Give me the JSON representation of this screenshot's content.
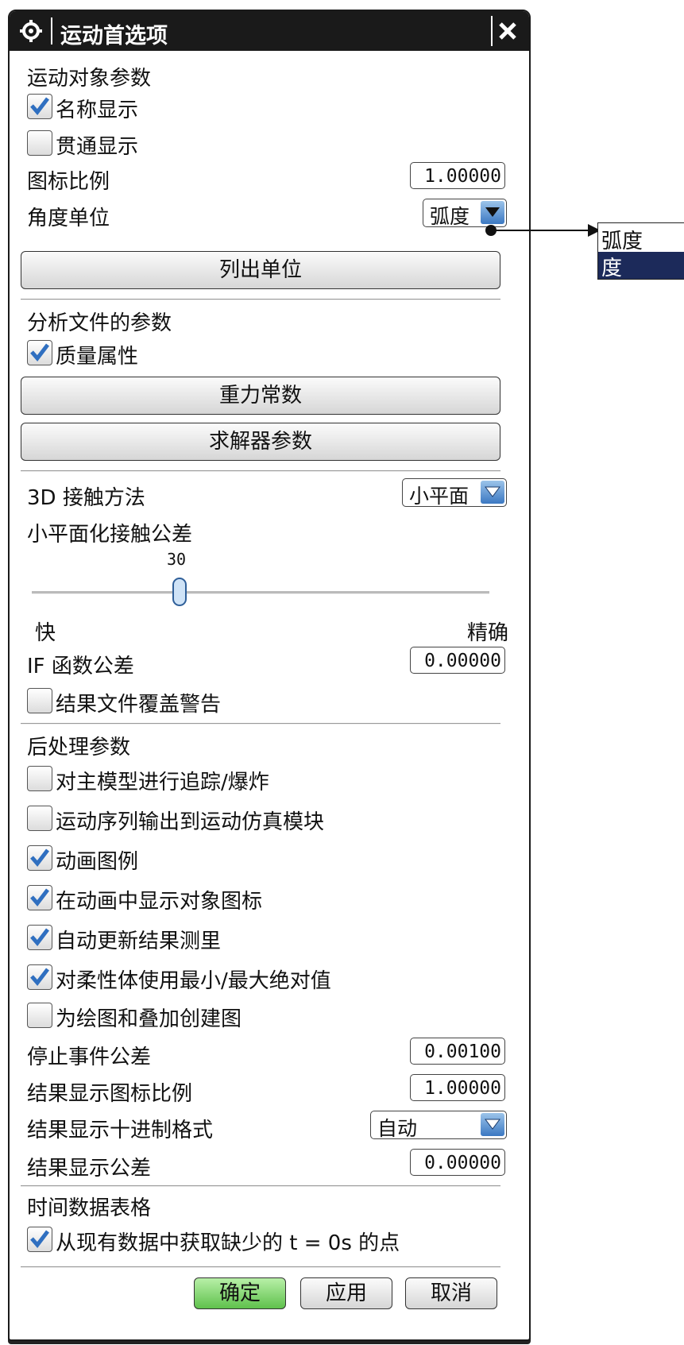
{
  "title": "运动首选项",
  "sections": {
    "motion_obj": "运动对象参数",
    "analysis": "分析文件的参数",
    "post": "后处理参数",
    "time": "时间数据表格"
  },
  "checkboxes": {
    "name_display": {
      "label": "名称显示",
      "checked": true
    },
    "through_display": {
      "label": "贯通显示",
      "checked": false
    },
    "mass_props": {
      "label": "质量属性",
      "checked": true
    },
    "result_overwrite": {
      "label": "结果文件覆盖警告",
      "checked": false
    },
    "trace_explode": {
      "label": "对主模型进行追踪/爆炸",
      "checked": false
    },
    "seq_output": {
      "label": "运动序列输出到运动仿真模块",
      "checked": false
    },
    "anim_legend": {
      "label": "动画图例",
      "checked": true
    },
    "show_icons": {
      "label": "在动画中显示对象图标",
      "checked": true
    },
    "auto_update": {
      "label": "自动更新结果测里",
      "checked": true
    },
    "flex_minmax": {
      "label": "对柔性体使用最小/最大绝对值",
      "checked": true
    },
    "plot_overlay": {
      "label": "为绘图和叠加创建图",
      "checked": false
    },
    "missing_pts": {
      "label": "从现有数据中获取缺少的 t = 0s 的点",
      "checked": true
    }
  },
  "fields": {
    "icon_scale": {
      "label": "图标比例",
      "value": "1.00000"
    },
    "if_tol": {
      "label": "IF 函数公差",
      "value": "0.00000"
    },
    "stop_tol": {
      "label": "停止事件公差",
      "value": "0.00100"
    },
    "res_icon_scale": {
      "label": "结果显示图标比例",
      "value": "1.00000"
    },
    "res_tol": {
      "label": "结果显示公差",
      "value": "0.00000"
    }
  },
  "selects": {
    "angle_unit": {
      "label": "角度单位",
      "value": "弧度",
      "options": [
        "弧度",
        "度"
      ],
      "highlighted": "度"
    },
    "contact_method": {
      "label": "3D 接触方法",
      "value": "小平面"
    },
    "decimal_format": {
      "label": "结果显示十进制格式",
      "value": "自动"
    }
  },
  "buttons": {
    "list_units": "列出单位",
    "gravity": "重力常数",
    "solver": "求解器参数",
    "ok": "确定",
    "apply": "应用",
    "cancel": "取消"
  },
  "slider": {
    "label": "小平面化接触公差",
    "value": "30",
    "fraction": 0.3,
    "left_label": "快",
    "right_label": "精确"
  },
  "icons": {
    "title": "gear-icon",
    "close": "close-icon"
  },
  "colors": {
    "titlebar": "#1a1a1a",
    "check": "#2f6fc0",
    "highlight": "#1c2a5a",
    "ok_green": "#5fc14c"
  }
}
